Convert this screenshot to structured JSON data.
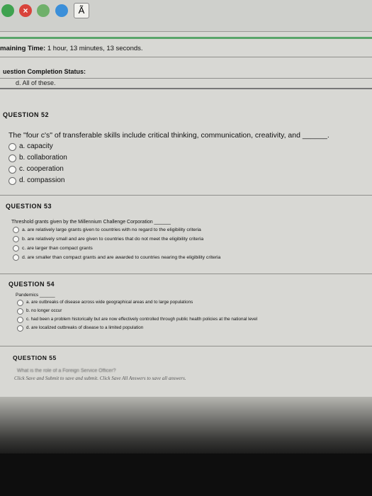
{
  "toolbar": {
    "icon5_glyph": "Ã"
  },
  "timer": {
    "label": "maining Time:",
    "value": "1 hour, 13 minutes, 13 seconds."
  },
  "status": {
    "label": "uestion Completion Status:"
  },
  "prev_option": "d. All of these.",
  "q52": {
    "title": "QUESTION 52",
    "text": "The \"four c's\" of transferable skills include critical thinking, communication, creativity, and ______.",
    "options": [
      "a. capacity",
      "b. collaboration",
      "c. cooperation",
      "d. compassion"
    ]
  },
  "q53": {
    "title": "QUESTION 53",
    "text": "Threshold grants given by the Millennium Challenge Corporation ______",
    "options": [
      "a. are relatively large grants given to countries with no regard to the eligibility criteria",
      "b. are relatively small and are given to countries that do not meet the eligibility criteria",
      "c. are larger than compact grants",
      "d. are smaller than compact grants and are awarded to countries nearing the eligibility criteria"
    ]
  },
  "q54": {
    "title": "QUESTION 54",
    "text": "Pandemics ______",
    "options": [
      "a. are outbreaks of disease across wide geographical areas and to large populations",
      "b. no longer occur",
      "c. had been a problem historically but are now effectively controlled through public health policies at the national level",
      "d. are localized outbreaks of disease to a limited population"
    ]
  },
  "q55": {
    "title": "QUESTION 55",
    "text": "What is the role of a Foreign Service Officer?"
  },
  "submit_note": "Click Save and Submit to save and submit. Click Save All Answers to save all answers."
}
